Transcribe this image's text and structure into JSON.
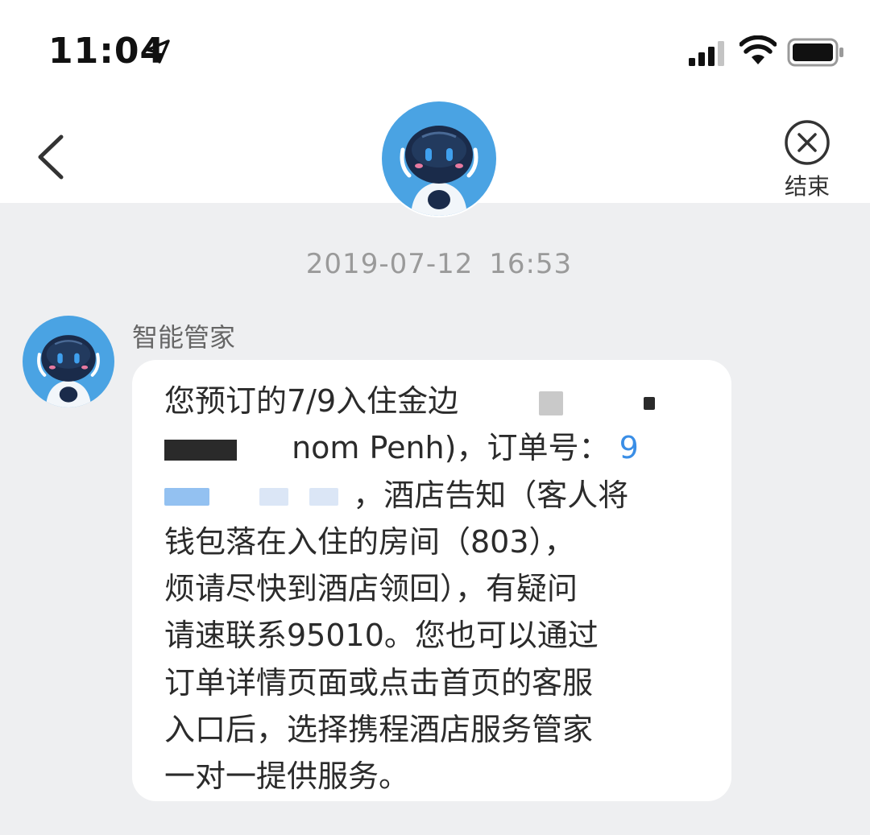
{
  "status_bar": {
    "time": "11:04",
    "icons": [
      "location-arrow-icon",
      "cellular-signal-icon",
      "wifi-icon",
      "battery-icon"
    ]
  },
  "nav": {
    "back_icon": "chevron-left-icon",
    "avatar": "robot-avatar",
    "end_icon": "close-circle-icon",
    "end_label": "结束"
  },
  "chat": {
    "timestamp": "2019-07-12  16:53",
    "message": {
      "sender": "智能管家",
      "line1_text": "您预订的7/9入住金边",
      "line2_text": "nom Penh)，订单号：",
      "line2_order_prefix": "9",
      "line3_text": "，酒店告知（客人将",
      "line4": "钱包落在入住的房间（803），",
      "line5": "烦请尽快到酒店领回），有疑问",
      "line6": "请速联系95010。您也可以通过",
      "line7": "订单详情页面或点击首页的客服",
      "line8": "入口后，选择携程酒店服务管家",
      "line9": "一对一提供服务。"
    }
  },
  "colors": {
    "background": "#eeeff1",
    "header": "#ffffff",
    "bubble": "#ffffff",
    "avatar_ring": "#4aa3e3",
    "robot_face": "#1a2b4a",
    "link_blue": "#3a8ee6",
    "timestamp_gray": "#9a9a9a"
  }
}
